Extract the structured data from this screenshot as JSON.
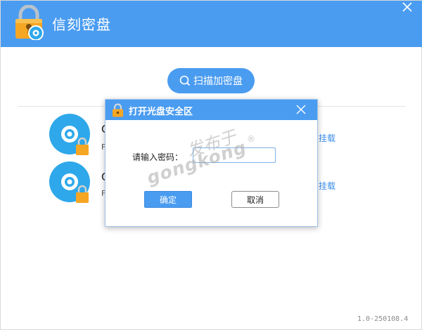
{
  "app": {
    "title": "信刻密盘",
    "version": "1.0-250108.4"
  },
  "toolbar": {
    "scan_label": "扫描加密盘"
  },
  "discs": [
    {
      "name": "C",
      "sub": "F",
      "mount_label": "挂载"
    },
    {
      "name": "C",
      "sub": "F",
      "mount_label": "挂载"
    }
  ],
  "dialog": {
    "title": "打开光盘安全区",
    "password_label": "请输入密码：",
    "password_value": "",
    "ok_label": "确定",
    "cancel_label": "取消"
  },
  "watermark": {
    "cn": "发布于",
    "en": "gongkong",
    "mark": "®"
  },
  "colors": {
    "accent": "#4a9cf0",
    "disc_blue": "#2ea8ea",
    "lock_orange": "#f5a623",
    "link": "#3d8ee6"
  },
  "icons": {
    "app": "lock-disc-icon",
    "close": "close-icon",
    "scan": "search-icon",
    "disc": "disc-icon",
    "lock": "padlock-icon"
  }
}
